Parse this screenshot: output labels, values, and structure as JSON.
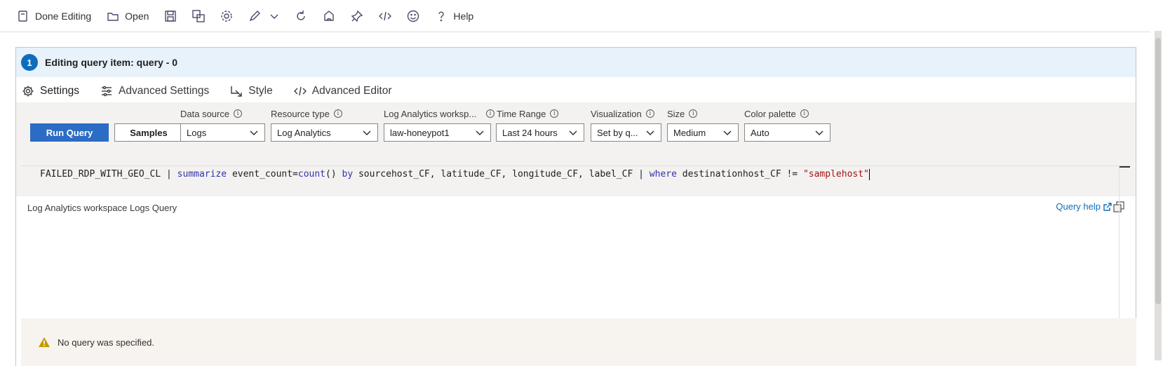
{
  "toolbar": {
    "done_editing": "Done Editing",
    "open": "Open",
    "help": "Help",
    "icons": [
      "done-editing-icon",
      "open-icon",
      "save-icon",
      "save-as-icon",
      "settings-icon",
      "edit-icon",
      "chevron-down-icon",
      "refresh-icon",
      "clone-icon",
      "pin-icon",
      "code-icon",
      "feedback-icon",
      "help-icon"
    ]
  },
  "banner": {
    "step": "1",
    "title": "Editing query item: query - 0"
  },
  "tabs": [
    {
      "label": "Settings",
      "icon": "gear-icon",
      "active": true
    },
    {
      "label": "Advanced Settings",
      "icon": "sliders-icon",
      "active": false
    },
    {
      "label": "Style",
      "icon": "style-icon",
      "active": false
    },
    {
      "label": "Advanced Editor",
      "icon": "code-icon",
      "active": false
    }
  ],
  "buttons": {
    "run_query": "Run Query",
    "samples": "Samples"
  },
  "fields": {
    "data_source": {
      "label": "Data source",
      "value": "Logs"
    },
    "resource_type": {
      "label": "Resource type",
      "value": "Log Analytics"
    },
    "workspace": {
      "label": "Log Analytics worksp...",
      "value": "law-honeypot1"
    },
    "time_range": {
      "label": "Time Range",
      "value": "Last 24 hours"
    },
    "visualization": {
      "label": "Visualization",
      "value": "Set by q..."
    },
    "size": {
      "label": "Size",
      "value": "Medium"
    },
    "color_palette": {
      "label": "Color palette",
      "value": "Auto"
    }
  },
  "query": {
    "label": "Log Analytics workspace Logs Query",
    "help_link": "Query help",
    "text": {
      "t1": "FAILED_RDP_WITH_GEO_CL | ",
      "k1": "summarize",
      "t2": " event_count=",
      "k2": "count",
      "t3": "() ",
      "k3": "by",
      "t4": " sourcehost_CF, latitude_CF, longitude_CF, label_CF | ",
      "k4": "where",
      "t5": " destinationhost_CF != ",
      "s1": "\"samplehost\""
    }
  },
  "warning": {
    "message": "No query was specified."
  },
  "colors": {
    "accent": "#0f6cbd",
    "banner_bg": "#e8f2fb",
    "keyword": "#3333aa",
    "string": "#a31515",
    "warning": "#c19c00"
  }
}
